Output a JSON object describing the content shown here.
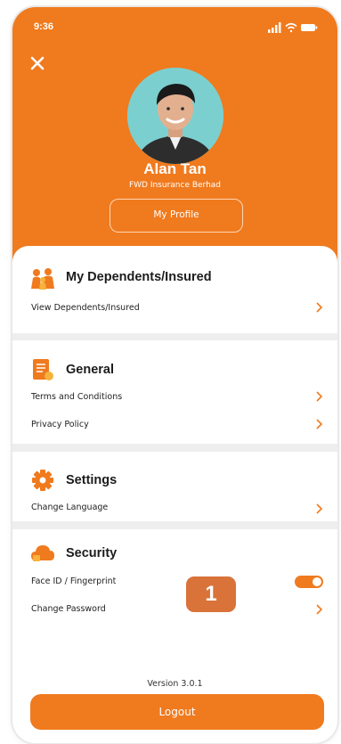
{
  "status_bar": {
    "time": "9:36"
  },
  "profile": {
    "name": "Alan Tan",
    "company": "FWD Insurance Berhad",
    "button_label": "My Profile"
  },
  "sections": {
    "dependents": {
      "title": "My Dependents/Insured",
      "items": [
        "View Dependents/Insured"
      ]
    },
    "general": {
      "title": "General",
      "items": [
        "Terms and Conditions",
        "Privacy Policy"
      ]
    },
    "settings": {
      "title": "Settings",
      "items": [
        "Change Language"
      ]
    },
    "security": {
      "title": "Security",
      "items": [
        "Face ID / Fingerprint",
        "Change Password"
      ],
      "face_id_enabled": true
    }
  },
  "callout_badge": "1",
  "version": "Version 3.0.1",
  "logout_label": "Logout",
  "colors": {
    "primary": "#f07a1e",
    "badge": "#d9733a"
  }
}
